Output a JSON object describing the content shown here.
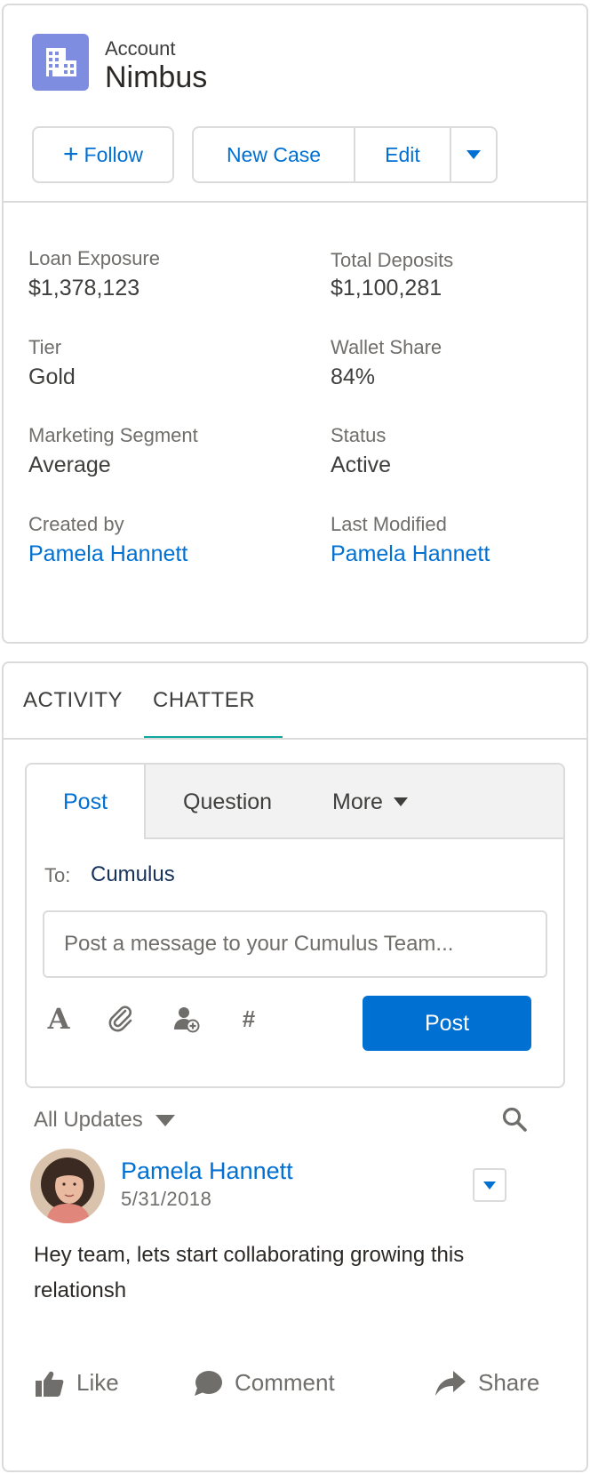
{
  "header": {
    "object_label": "Account",
    "record_name": "Nimbus",
    "icon": "account-building-icon",
    "icon_color": "#7f8de1"
  },
  "actions": {
    "follow_plus": "+",
    "follow_label": "Follow",
    "new_case_label": "New Case",
    "edit_label": "Edit"
  },
  "fields": {
    "loan_exposure": {
      "label": "Loan Exposure",
      "value": "$1,378,123"
    },
    "total_deposits": {
      "label": "Total Deposits",
      "value": "$1,100,281"
    },
    "tier": {
      "label": "Tier",
      "value": "Gold"
    },
    "wallet_share": {
      "label": "Wallet Share",
      "value": "84%"
    },
    "marketing_segment": {
      "label": "Marketing Segment",
      "value": "Average"
    },
    "status": {
      "label": "Status",
      "value": "Active"
    },
    "created_by": {
      "label": "Created by",
      "value": "Pamela Hannett"
    },
    "last_modified": {
      "label": "Last Modified",
      "value": "Pamela Hannett"
    }
  },
  "tabs": {
    "activity": "ACTIVITY",
    "chatter": "CHATTER",
    "active": "chatter"
  },
  "publisher": {
    "tab_post": "Post",
    "tab_question": "Question",
    "tab_more": "More",
    "to_label": "To:",
    "to_value": "Cumulus",
    "message_placeholder": "Post a message to your Cumulus Team...",
    "post_button": "Post",
    "tools": [
      "text-format-icon",
      "attachment-icon",
      "mention-user-icon",
      "hashtag-icon"
    ],
    "hashtag_glyph": "#",
    "format_glyph": "A"
  },
  "feed": {
    "filter_label": "All Updates",
    "post": {
      "author": "Pamela Hannett",
      "date": "5/31/2018",
      "body": "Hey team, lets start collaborating growing this relationsh"
    },
    "like_label": "Like",
    "comment_label": "Comment",
    "share_label": "Share"
  },
  "colors": {
    "brand_blue": "#0070d2",
    "tab_accent": "#10a89e",
    "border": "#dddbda"
  }
}
